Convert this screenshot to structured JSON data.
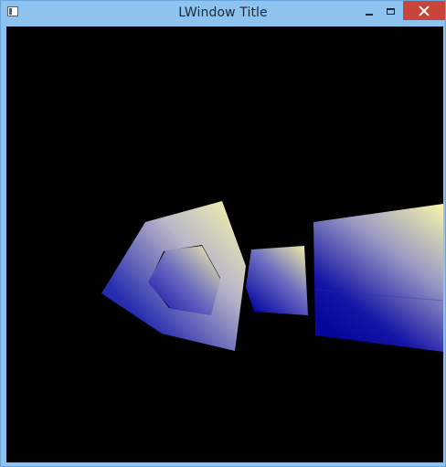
{
  "window": {
    "title": "LWindow Title"
  },
  "controls": {
    "minimize_icon": "minimize-icon",
    "maximize_icon": "maximize-icon",
    "close_icon": "close-icon"
  },
  "colors": {
    "titlebar": "#8ec3ef",
    "close_button": "#c9453a",
    "viewport_background": "#000000",
    "gradient_light": "#f6f3a6",
    "gradient_dark": "#0a0aa0"
  }
}
